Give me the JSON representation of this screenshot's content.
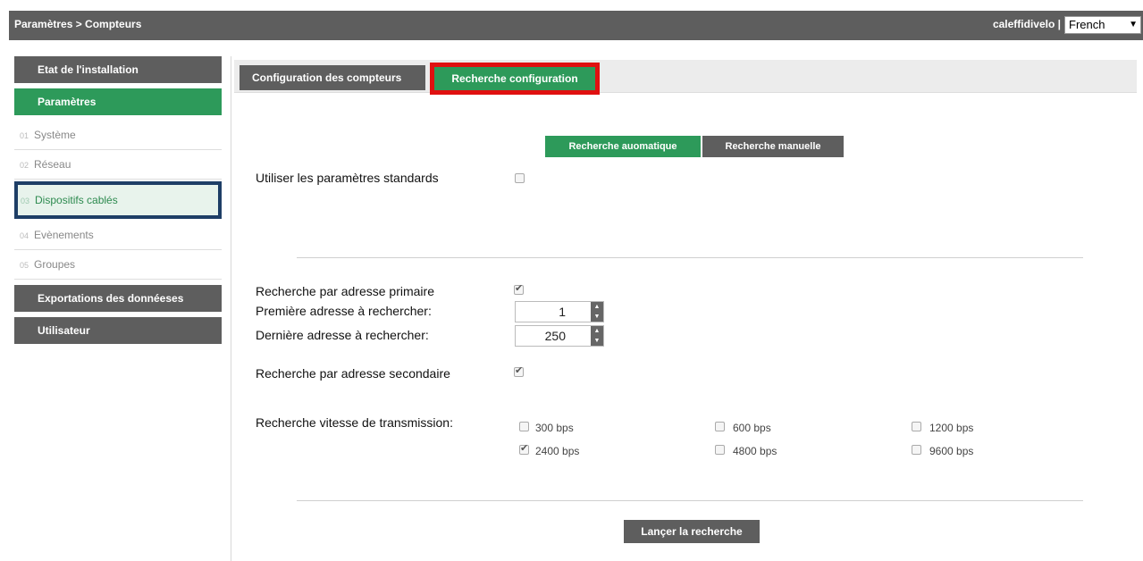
{
  "header": {
    "breadcrumb": "Paramètres > Compteurs",
    "user": "caleffidivelo |",
    "language": "French"
  },
  "sidebar": {
    "sections": [
      {
        "label": "Etat de l'installation"
      },
      {
        "label": "Paramètres"
      }
    ],
    "items": [
      {
        "num": "01",
        "label": "Système"
      },
      {
        "num": "02",
        "label": "Réseau"
      },
      {
        "num": "03",
        "label": "Dispositifs cablés"
      },
      {
        "num": "04",
        "label": "Evènements"
      },
      {
        "num": "05",
        "label": "Groupes"
      }
    ],
    "bottom": [
      {
        "label": "Exportations des donnéeses"
      },
      {
        "label": "Utilisateur"
      }
    ]
  },
  "tabs": [
    {
      "label": "Configuration des compteurs"
    },
    {
      "label": "Recherche configuration"
    }
  ],
  "search_mode": {
    "auto_label": "Recherche auomatique",
    "manual_label": "Recherche manuelle"
  },
  "form": {
    "standard_params_label": "Utiliser les paramètres standards",
    "primary_label": "Recherche par adresse primaire",
    "first_label": "Première adresse à rechercher:",
    "first_value": "1",
    "last_label": "Dernière adresse à rechercher:",
    "last_value": "250",
    "secondary_label": "Recherche par adresse secondaire",
    "baud_label": "Recherche vitesse de transmission:",
    "baud_options": [
      "300 bps",
      "600 bps",
      "1200 bps",
      "2400 bps",
      "4800 bps",
      "9600 bps"
    ],
    "launch_label": "Lançer la recherche"
  }
}
